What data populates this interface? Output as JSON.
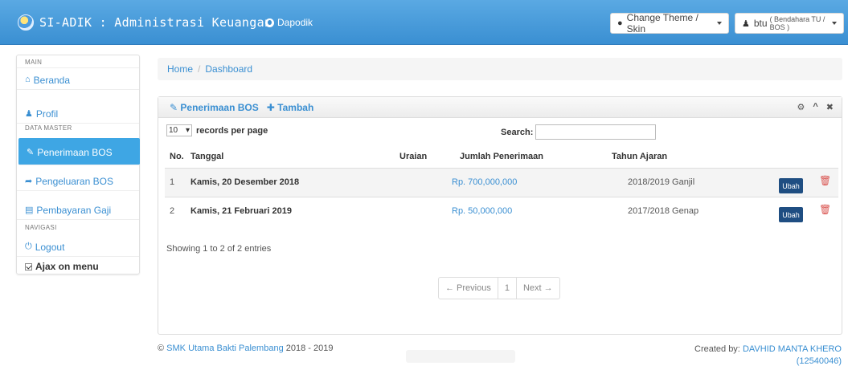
{
  "navbar": {
    "brand": "SI-ADIK : Administrasi Keuangan",
    "dapodik": "Dapodik",
    "theme_label": "Change Theme / Skin",
    "user_name": "btu",
    "user_role": "( Bendahara TU / BOS )"
  },
  "sidebar": {
    "section_main": "MAIN",
    "beranda": "Beranda",
    "profil": "Profil",
    "section_master": "DATA MASTER",
    "penerimaan": "Penerimaan BOS",
    "pengeluaran": "Pengeluaran BOS",
    "pembayaran": "Pembayaran Gaji",
    "section_nav": "NAVIGASI",
    "logout": "Logout",
    "ajax": "Ajax on menu"
  },
  "breadcrumb": {
    "home": "Home",
    "separator": "/",
    "current": "Dashboard"
  },
  "panel": {
    "title": "Penerimaan BOS",
    "add_label": "Tambah",
    "records_value": "10",
    "records_label": "records per page",
    "search_label": "Search:",
    "columns": [
      "No.",
      "Tanggal",
      "Uraian",
      "Jumlah Penerimaan",
      "Tahun Ajaran"
    ],
    "rows": [
      {
        "no": "1",
        "tanggal": "Kamis, 20 Desember 2018",
        "uraian": "",
        "jumlah": "Rp. 700,000,000",
        "tahun": "2018/2019 Ganjil",
        "action": "Ubah"
      },
      {
        "no": "2",
        "tanggal": "Kamis, 21 Februari 2019",
        "uraian": "",
        "jumlah": "Rp. 50,000,000",
        "tahun": "2017/2018 Genap",
        "action": "Ubah"
      }
    ],
    "info": "Showing 1 to 2 of 2 entries",
    "pager": {
      "prev": "← Previous",
      "page": "1",
      "next": "Next →"
    }
  },
  "footer": {
    "copyright": "©",
    "school": "SMK Utama Bakti Palembang",
    "years": "2018 - 2019",
    "created_by": "Created by:",
    "author": "DAVHID MANTA KHERO",
    "nim": "(12540046)"
  },
  "colors": {
    "navbar": "#3a8fd2",
    "link": "#3a8fd2",
    "active": "#3ea6e4",
    "button": "#1f4e82",
    "danger": "#d9534f"
  }
}
